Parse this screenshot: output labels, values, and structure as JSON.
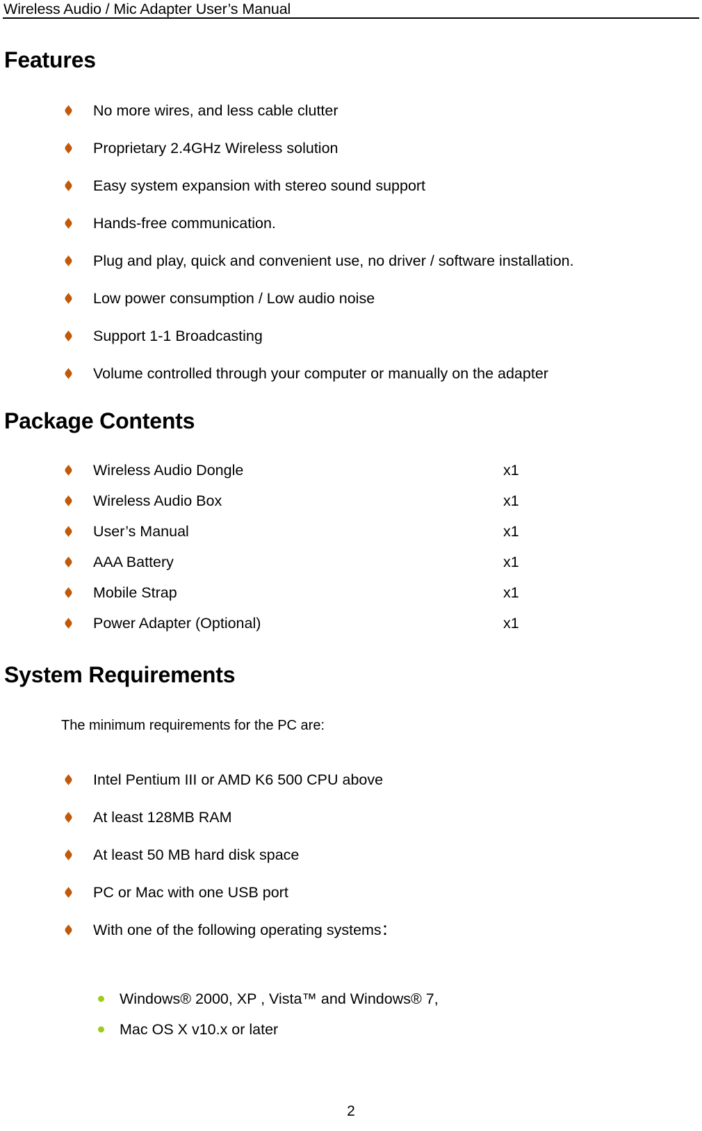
{
  "document": {
    "header_title": "Wireless Audio / Mic Adapter User’s Manual",
    "page_number": "2"
  },
  "colors": {
    "bullet_orange": "#C05A0A",
    "subbullet_green": "#9FCC1B",
    "text": "#000000",
    "rule": "#000000",
    "background": "#FFFFFF"
  },
  "sections": {
    "features": {
      "title": "Features",
      "items": [
        {
          "text": "No more wires, and less cable clutter"
        },
        {
          "text": "Proprietary 2.4GHz Wireless solution"
        },
        {
          "text": "Easy system expansion with stereo sound support"
        },
        {
          "text": "Hands-free communication."
        },
        {
          "text": "Plug and play, quick and convenient use, no driver / software installation."
        },
        {
          "text": "Low power consumption / Low audio noise"
        },
        {
          "text": "Support 1-1 Broadcasting"
        },
        {
          "text": "Volume controlled through your computer or manually on the adapter"
        }
      ]
    },
    "package_contents": {
      "title": "Package Contents",
      "items": [
        {
          "text": "Wireless Audio Dongle",
          "qty": "x1"
        },
        {
          "text": "Wireless Audio Box",
          "qty": "x1"
        },
        {
          "text": "User’s Manual",
          "qty": "x1"
        },
        {
          "text": "AAA Battery",
          "qty": "x1"
        },
        {
          "text": "Mobile Strap",
          "qty": "x1"
        },
        {
          "text": "Power Adapter (Optional)",
          "qty": "x1"
        }
      ]
    },
    "system_requirements": {
      "title": "System Requirements",
      "lead_in": "The minimum requirements for the PC are:",
      "items": [
        {
          "text": "Intel Pentium III or AMD K6 500 CPU above"
        },
        {
          "text": "At least 128MB RAM"
        },
        {
          "text": "At least 50 MB hard disk space"
        },
        {
          "text": "PC or Mac with one USB port"
        },
        {
          "text": "With one of the following operating systems："
        }
      ],
      "operating_systems": [
        {
          "text": "Windows® 2000, XP , Vista™ and Windows® 7,"
        },
        {
          "text": "Mac OS X v10.x or later"
        }
      ]
    }
  }
}
